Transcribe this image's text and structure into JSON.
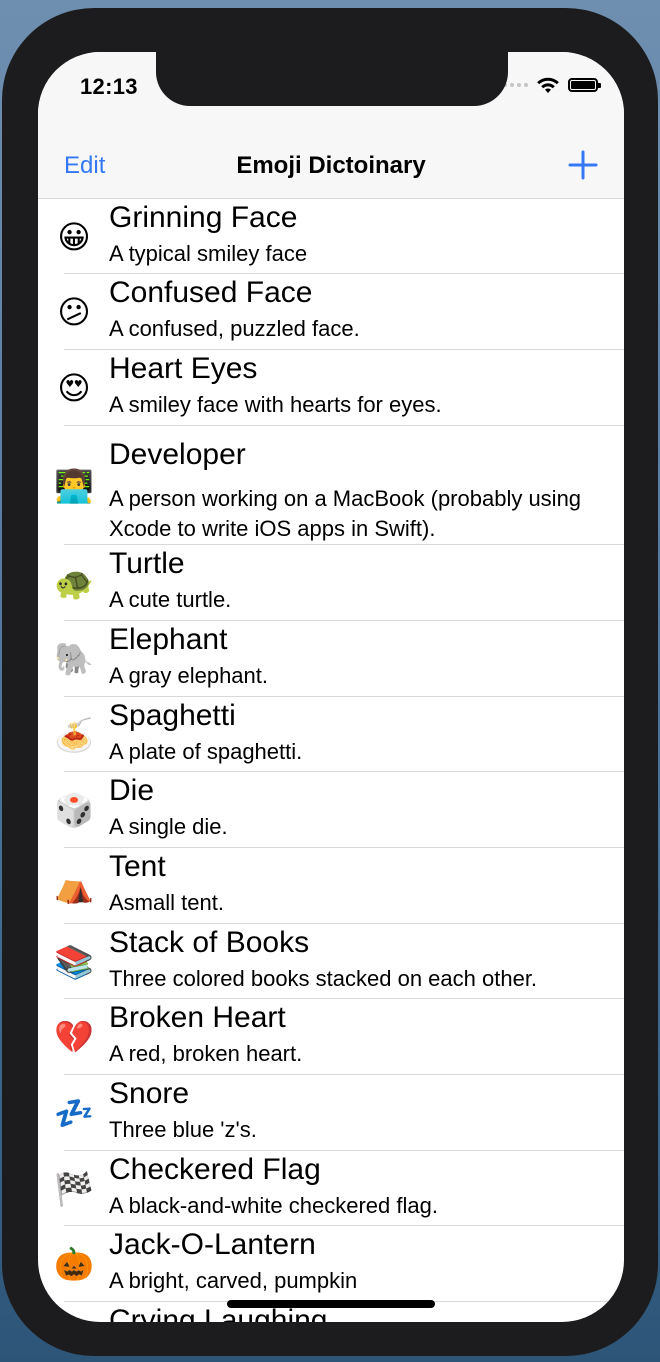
{
  "status_bar": {
    "time": "12:13"
  },
  "navbar": {
    "left_label": "Edit",
    "title": "Emoji Dictoinary",
    "add_icon": "plus-icon"
  },
  "emojis": [
    {
      "symbol": "😀",
      "name": "Grinning Face",
      "description": "A typical smiley face"
    },
    {
      "symbol": "😕",
      "name": "Confused Face",
      "description": "A confused, puzzled face."
    },
    {
      "symbol": "😍",
      "name": "Heart Eyes",
      "description": "A smiley face with hearts for eyes."
    },
    {
      "symbol": "👨‍💻",
      "name": "Developer",
      "description": "A person working on a MacBook (probably using Xcode to write iOS apps in Swift)."
    },
    {
      "symbol": "🐢",
      "name": "Turtle",
      "description": "A cute turtle."
    },
    {
      "symbol": "🐘",
      "name": "Elephant",
      "description": "A gray elephant."
    },
    {
      "symbol": "🍝",
      "name": "Spaghetti",
      "description": "A plate of spaghetti."
    },
    {
      "symbol": "🎲",
      "name": "Die",
      "description": "A single die."
    },
    {
      "symbol": "⛺",
      "name": "Tent",
      "description": "Asmall tent."
    },
    {
      "symbol": "📚",
      "name": "Stack of Books",
      "description": "Three colored books stacked on each other."
    },
    {
      "symbol": "💔",
      "name": "Broken Heart",
      "description": "A red, broken heart."
    },
    {
      "symbol": "💤",
      "name": "Snore",
      "description": "Three blue 'z's."
    },
    {
      "symbol": "🏁",
      "name": "Checkered Flag",
      "description": "A black-and-white checkered flag."
    },
    {
      "symbol": "🎃",
      "name": "Jack-O-Lantern",
      "description": "A bright, carved, pumpkin"
    },
    {
      "symbol": "",
      "name": "Crying Laughing",
      "description": ""
    }
  ],
  "colors": {
    "tint": "#3478f6",
    "bar_background": "#f7f7f7",
    "separator": "#d9d9d9"
  }
}
